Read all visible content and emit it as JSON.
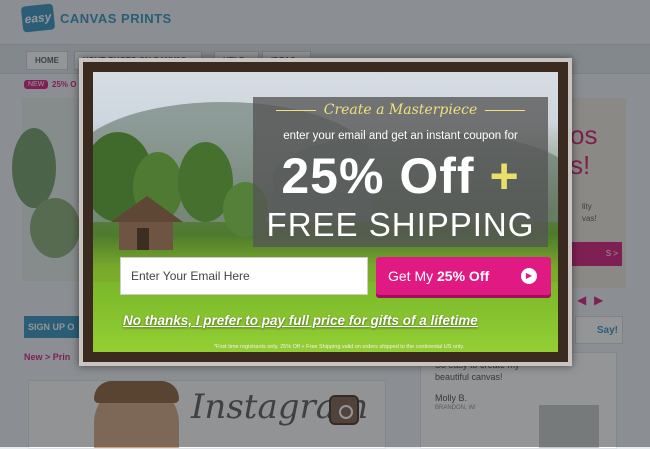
{
  "site": {
    "logo_badge": "easy",
    "logo_text": "CANVAS PRINTS",
    "nav": [
      "HOME",
      "YOUR PHOTO ON CANVAS ▾",
      "HELP ▾",
      "IDEAS ▾"
    ],
    "promo_badge": "NEW",
    "promo_text": "25% O",
    "right_heading_1": "os",
    "right_heading_2": "s!",
    "right_small_1": "lity",
    "right_small_2": "vas!",
    "right_button": "S >",
    "arrow_prev": "◀",
    "arrow_next": "▶",
    "says": "Say!",
    "signup": "SIGN UP O",
    "breadcrumb": "New > Prin",
    "instagram_text": "Instagram",
    "testimonial_quote": "So easy to create my beautiful canvas!",
    "testimonial_name": "Molly B.",
    "testimonial_location": "BRANDON, WI"
  },
  "modal": {
    "tagline": "Create a Masterpiece",
    "subtitle": "enter your email and get an instant coupon for",
    "discount": "25% Off",
    "plus": "+",
    "shipping": "FREE SHIPPING",
    "email_placeholder": "Enter Your Email Here",
    "cta_prefix": "Get My ",
    "cta_bold": "25% Off",
    "cta_icon": "play-circle-icon",
    "decline": "No thanks, I prefer to pay full price for gifts of a lifetime",
    "fine_print": "*First time registrants only. 25% Off + Free Shipping valid on orders shipped to the continental US only."
  },
  "colors": {
    "brand": "#2e8fbf",
    "accent": "#e01983",
    "headline": "#ffffff",
    "tagline": "#f1e07b"
  }
}
